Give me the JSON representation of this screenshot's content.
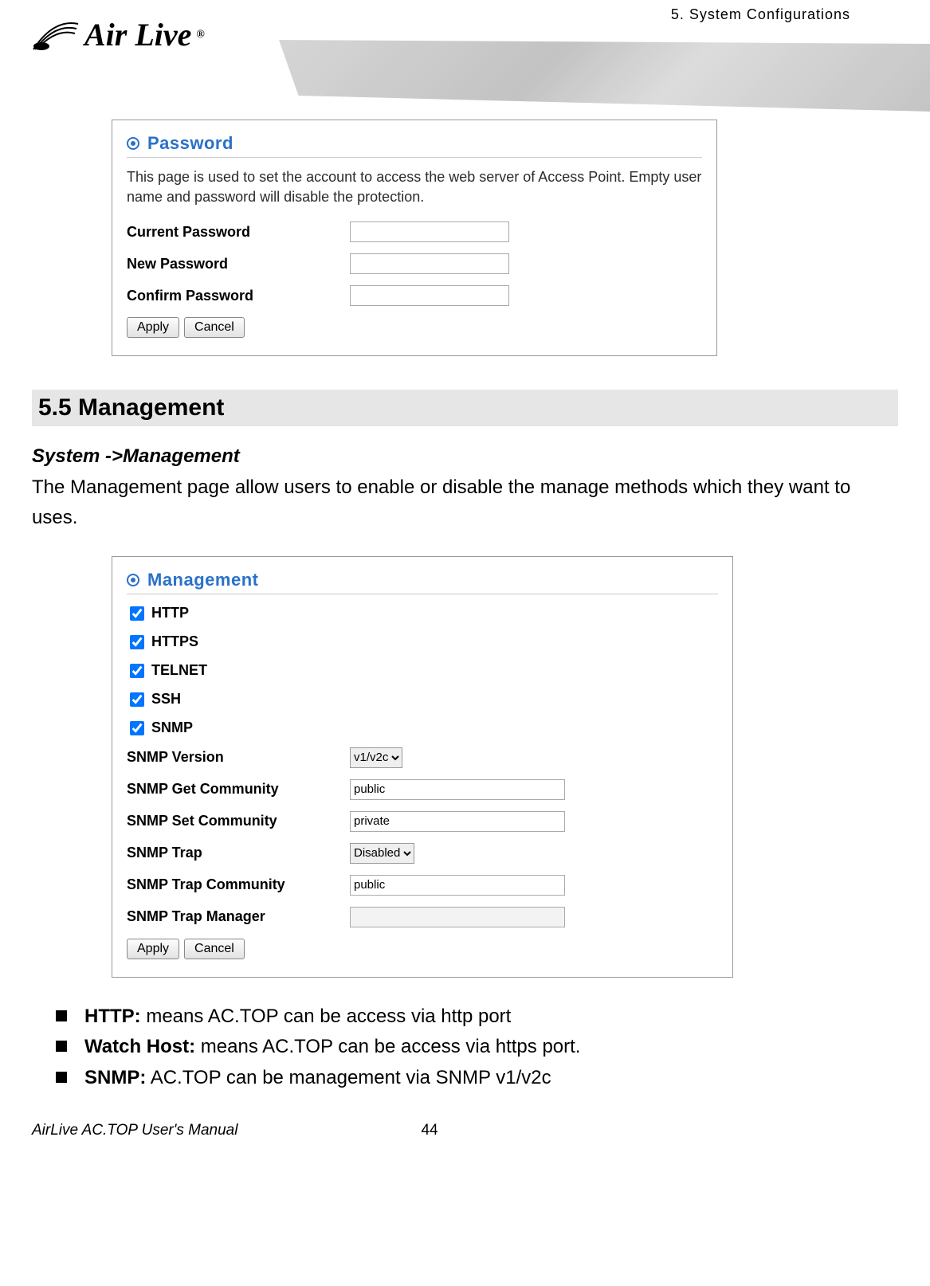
{
  "header": {
    "chapter_label": "5.  System  Configurations",
    "logo_text": "Air Live",
    "logo_tm": "®"
  },
  "password_panel": {
    "title": "Password",
    "description": "This page is used to set the account to access the web server of Access Point. Empty user name and password will disable the protection.",
    "fields": {
      "current_label": "Current Password",
      "new_label": "New Password",
      "confirm_label": "Confirm Password",
      "current_value": "",
      "new_value": "",
      "confirm_value": ""
    },
    "apply_label": "Apply",
    "cancel_label": "Cancel"
  },
  "section": {
    "heading": "5.5 Management",
    "nav_path": "System ->Management",
    "intro": "The Management page allow users to enable or disable the manage methods which they want to uses."
  },
  "management_panel": {
    "title": "Management",
    "checks": {
      "http": "HTTP",
      "https": "HTTPS",
      "telnet": "TELNET",
      "ssh": "SSH",
      "snmp": "SNMP"
    },
    "fields": {
      "snmp_version_label": "SNMP Version",
      "snmp_version_value": "v1/v2c",
      "snmp_get_label": "SNMP Get Community",
      "snmp_get_value": "public",
      "snmp_set_label": "SNMP Set Community",
      "snmp_set_value": "private",
      "snmp_trap_label": "SNMP Trap",
      "snmp_trap_value": "Disabled",
      "snmp_trap_comm_label": "SNMP Trap Community",
      "snmp_trap_comm_value": "public",
      "snmp_trap_mgr_label": "SNMP Trap Manager",
      "snmp_trap_mgr_value": ""
    },
    "apply_label": "Apply",
    "cancel_label": "Cancel"
  },
  "bullets": {
    "b1_label": "HTTP:",
    "b1_text": "   means AC.TOP can be access via http port",
    "b2_label": "Watch Host:",
    "b2_text": " means AC.TOP can be access via https port.",
    "b3_label": "SNMP:",
    "b3_text": " AC.TOP can be management via SNMP v1/v2c"
  },
  "footer": {
    "left": "AirLive AC.TOP User's Manual",
    "page": "44"
  }
}
